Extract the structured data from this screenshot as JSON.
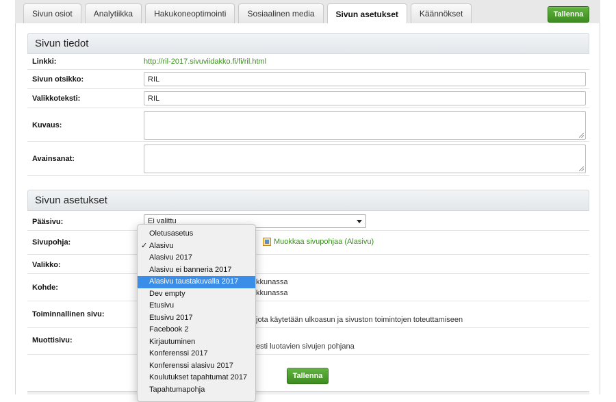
{
  "tabs": [
    {
      "label": "Sivun osiot",
      "active": false
    },
    {
      "label": "Analytiikka",
      "active": false
    },
    {
      "label": "Hakukoneoptimointi",
      "active": false
    },
    {
      "label": "Sosiaalinen media",
      "active": false
    },
    {
      "label": "Sivun asetukset",
      "active": true
    },
    {
      "label": "Käännökset",
      "active": false
    }
  ],
  "save_label": "Tallenna",
  "section1": {
    "title": "Sivun tiedot",
    "link_label": "Linkki:",
    "link_value": "http://ril-2017.sivuviidakko.fi/fi/ril.html",
    "page_title_label": "Sivun otsikko:",
    "page_title_value": "RIL",
    "menu_text_label": "Valikkoteksti:",
    "menu_text_value": "RIL",
    "description_label": "Kuvaus:",
    "keywords_label": "Avainsanat:"
  },
  "section2": {
    "title": "Sivun asetukset",
    "parent_label": "Pääsivu:",
    "parent_value": "Ei valittu",
    "template_label": "Sivupohja:",
    "edit_template_link": "Muokkaa sivupohjaa (Alasivu)",
    "menu_label": "Valikko:",
    "target_label": "Kohde:",
    "target_text_1": "kkunassa",
    "target_text_2": "kkunassa",
    "functional_label": "Toiminnallinen sivu:",
    "functional_text": "jota käytetään ulkoasun ja sivuston toimintojen toteuttamiseen",
    "template_page_label": "Muottisivu:",
    "template_page_text": "esti luotavien sivujen pohjana"
  },
  "dropdown": {
    "selected": "Alasivu",
    "highlighted": "Alasivu taustakuvalla 2017",
    "options": [
      "Oletusasetus",
      "Alasivu",
      "Alasivu 2017",
      "Alasivu ei banneria 2017",
      "Alasivu taustakuvalla 2017",
      "Dev empty",
      "Etusivu",
      "Etusivu 2017",
      "Facebook 2",
      "Kirjautuminen",
      "Konferenssi 2017",
      "Konferenssi alasivu 2017",
      "Koulutukset tapahtumat 2017",
      "Tapahtumapohja"
    ]
  },
  "colors": {
    "accent_green": "#3d8b21",
    "link_green": "#3a8f1e",
    "highlight_blue": "#3b8ee8"
  }
}
